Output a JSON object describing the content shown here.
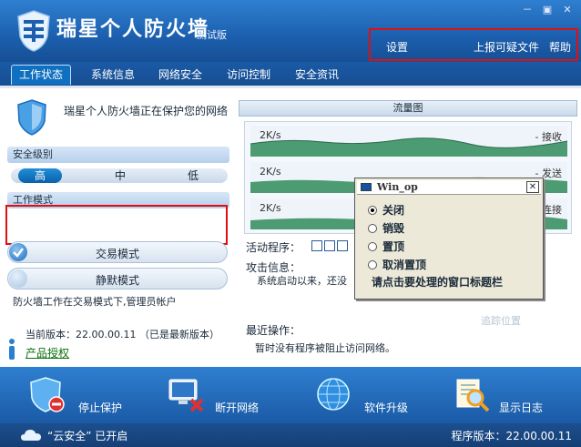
{
  "app": {
    "title": "瑞星个人防火墙",
    "subtitle": "测试版"
  },
  "window_controls": {
    "minimize": "－",
    "maximize": "▣",
    "close": "✕"
  },
  "header_links": {
    "settings": "设置",
    "report": "上报可疑文件",
    "help": "帮助"
  },
  "tabs": [
    {
      "label": "工作状态",
      "active": true
    },
    {
      "label": "系统信息"
    },
    {
      "label": "网络安全"
    },
    {
      "label": "访问控制"
    },
    {
      "label": "安全资讯"
    }
  ],
  "status": {
    "message": "瑞星个人防火墙正在保护您的网络"
  },
  "security_level": {
    "header": "安全级别",
    "levels": [
      "高",
      "中",
      "低"
    ],
    "selected": "高"
  },
  "work_mode": {
    "header": "工作模式",
    "interactive": "交易模式",
    "silent": "静默模式",
    "description": "防火墙工作在交易模式下,管理员帐户"
  },
  "version": {
    "current": "当前版本：22.00.00.11   （已是最新版本）",
    "license_link": "产品授权"
  },
  "flow": {
    "title": "流量图",
    "lanes": [
      {
        "rate": "2K/s",
        "tag": "- 接收"
      },
      {
        "rate": "2K/s",
        "tag": "- 发送"
      },
      {
        "rate": "2K/s",
        "tag": "连接"
      }
    ]
  },
  "activity": {
    "label": "活动程序：",
    "attack_label": "攻击信息：",
    "attack_detail": "系统启动以来，还没",
    "trace": "追踪位置",
    "recent_label": "最近操作：",
    "recent_detail": "暂时没有程序被阻止访问网络。"
  },
  "popup": {
    "title": "Win_op",
    "close": "✕",
    "options": [
      {
        "label": "关闭",
        "checked": true
      },
      {
        "label": "销毁",
        "checked": false
      },
      {
        "label": "置顶",
        "checked": false
      },
      {
        "label": "取消置顶",
        "checked": false
      }
    ],
    "hint": "请点击要处理的窗口标题栏"
  },
  "toolbar": {
    "stop": "停止保护",
    "disconnect": "断开网络",
    "upgrade": "软件升级",
    "log": "显示日志"
  },
  "statusbar": {
    "cloud": "“云安全” 已开启",
    "program_version": "程序版本：22.00.00.11"
  },
  "colors": {
    "accent": "#1c5fae",
    "highlight_box": "#e01010",
    "license_link": "#0a6f0a"
  }
}
